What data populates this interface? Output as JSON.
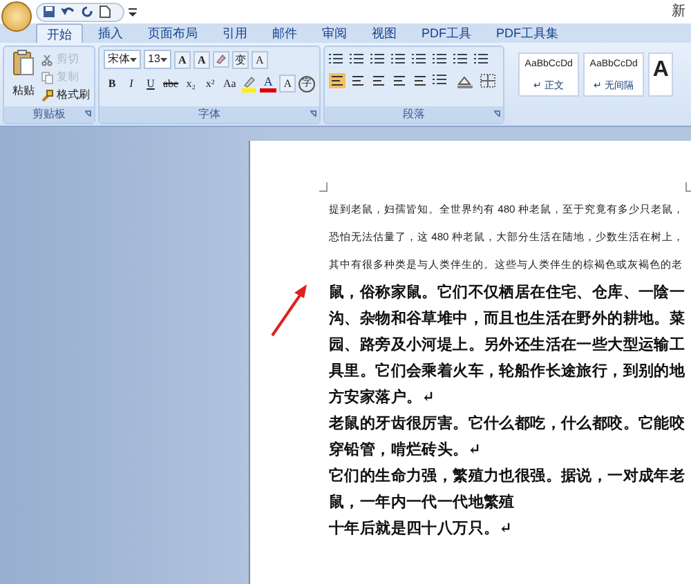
{
  "title_bar": {
    "title": "新"
  },
  "tabs": [
    {
      "label": "开始",
      "selected": true
    },
    {
      "label": "插入",
      "selected": false
    },
    {
      "label": "页面布局",
      "selected": false
    },
    {
      "label": "引用",
      "selected": false
    },
    {
      "label": "邮件",
      "selected": false
    },
    {
      "label": "审阅",
      "selected": false
    },
    {
      "label": "视图",
      "selected": false
    },
    {
      "label": "PDF工具",
      "selected": false
    },
    {
      "label": "PDF工具集",
      "selected": false
    }
  ],
  "clipboard": {
    "label": "剪贴板",
    "paste": "粘贴",
    "actions": [
      {
        "label": "剪切",
        "disabled": true
      },
      {
        "label": "复制",
        "disabled": true
      },
      {
        "label": "格式刷",
        "disabled": false
      }
    ]
  },
  "font": {
    "label": "字体",
    "font_name": "宋体",
    "font_size": "13",
    "grow": "A",
    "shrink": "A",
    "phonetic": "变",
    "char_border": "A",
    "format_buttons": [
      "B",
      "I",
      "U",
      "abe",
      "x₂",
      "x²",
      "Aa"
    ],
    "font_color_letter": "A",
    "shading_letter": "A",
    "enclose": "字"
  },
  "paragraph": {
    "label": "段落"
  },
  "styles": [
    {
      "preview": "AaBbCcDd",
      "name": "↵ 正文"
    },
    {
      "preview": "AaBbCcDd",
      "name": "↵ 无间隔"
    },
    {
      "preview": "A"
    }
  ],
  "document": {
    "lines": [
      {
        "kind": "small",
        "text": "提到老鼠，妇孺皆知。全世界约有 480 种老鼠，至于究竟有多少只老鼠，"
      },
      {
        "kind": "small",
        "text": "恐怕无法估量了，这 480 种老鼠，大部分生活在陆地，少数生活在树上，"
      },
      {
        "kind": "small",
        "text": "其中有很多种类是与人类伴生的。这些与人类伴生的棕褐色或灰褐色的老"
      },
      {
        "kind": "bold",
        "text": "鼠，俗称家鼠。它们不仅栖居在住宅、仓库、一陰一"
      },
      {
        "kind": "bold",
        "text": "沟、杂物和谷草堆中，而且也生活在野外的耕地。菜"
      },
      {
        "kind": "bold",
        "text": "园、路旁及小河堤上。另外还生活在一些大型运输工"
      },
      {
        "kind": "bold",
        "text": "具里。它们会乘着火车，轮船作长途旅行，到别的地"
      },
      {
        "kind": "bold",
        "text": "方安家落户。↵"
      },
      {
        "kind": "bold",
        "text": "老鼠的牙齿很厉害。它什么都吃，什么都咬。它能咬"
      },
      {
        "kind": "bold",
        "text": "穿铅管，啃烂砖头。↵"
      },
      {
        "kind": "bold",
        "text": "它们的生命力强，繁殖力也很强。据说，一对成年老"
      },
      {
        "kind": "bold",
        "text": "鼠，一年内一代一代地繁殖"
      },
      {
        "kind": "bold",
        "text": "十年后就是四十八万只。↵"
      }
    ]
  }
}
